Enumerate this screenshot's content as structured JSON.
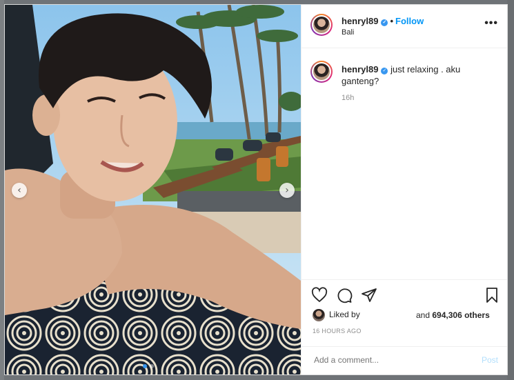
{
  "post": {
    "username": "henryl89",
    "verified_mark": "✓",
    "separator": "•",
    "follow_label": "Follow",
    "location": "Bali",
    "more_label": "•••",
    "caption_text": "just relaxing . aku ganteng?",
    "caption_time": "16h",
    "liked_by_label": "Liked by",
    "likes_and": "and",
    "likes_count": "694,306 others",
    "timestamp": "16 HOURS AGO",
    "comment_placeholder": "Add a comment...",
    "post_label": "Post"
  },
  "icons": {
    "like": "heart-icon",
    "comment": "comment-icon",
    "share": "share-icon",
    "save": "bookmark-icon",
    "prev": "chevron-left-icon",
    "next": "chevron-right-icon"
  },
  "colors": {
    "accent": "#0095f6",
    "post_disabled": "#b2dffc",
    "muted": "#8e8e8e"
  },
  "carousel": {
    "prev_glyph": "‹",
    "next_glyph": "›"
  }
}
